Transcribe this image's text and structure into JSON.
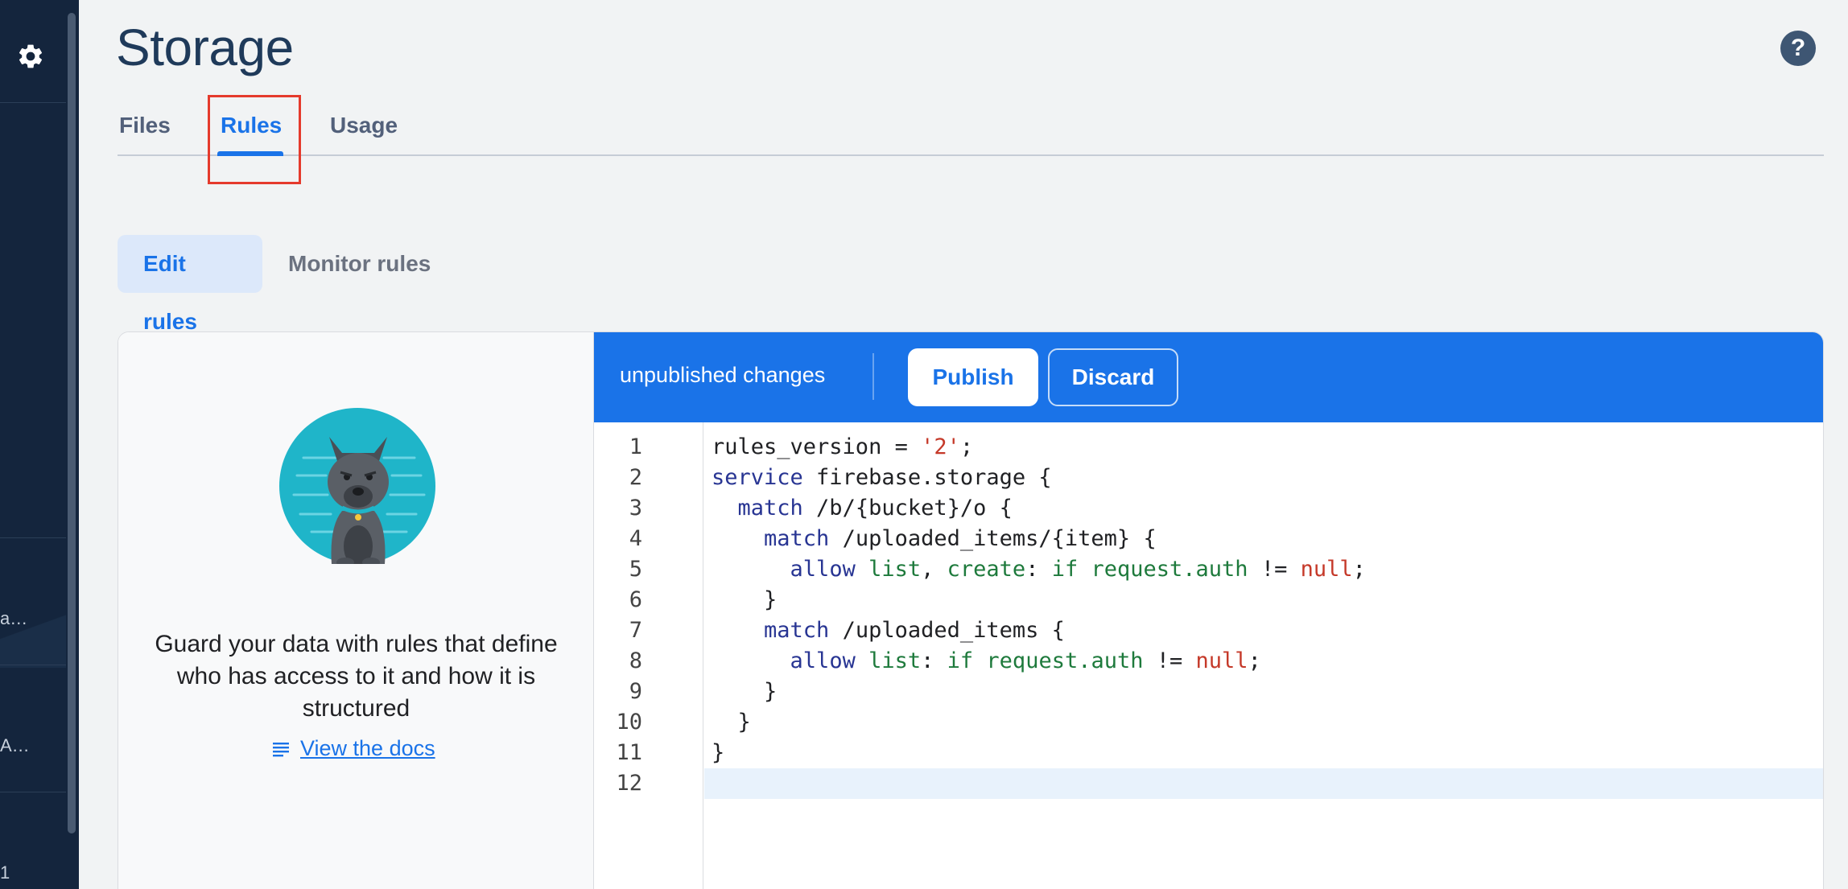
{
  "sidebar": {
    "gear_icon": "gear-icon",
    "text_a": "a…",
    "text_b": "A…",
    "text_c": "1"
  },
  "header": {
    "title": "Storage",
    "help_icon": "help-icon",
    "help_glyph": "?"
  },
  "tabs": [
    {
      "label": "Files",
      "active": false
    },
    {
      "label": "Rules",
      "active": true
    },
    {
      "label": "Usage",
      "active": false
    }
  ],
  "subtabs": {
    "edit": "Edit rules",
    "monitor": "Monitor rules"
  },
  "info_panel": {
    "text": "Guard your data with rules that define who has access to it and how it is structured",
    "docs_link": "View the docs"
  },
  "editor": {
    "status": "unpublished changes",
    "publish_label": "Publish",
    "discard_label": "Discard",
    "line_numbers": [
      "1",
      "2",
      "3",
      "4",
      "5",
      "6",
      "7",
      "8",
      "9",
      "10",
      "11",
      "12"
    ],
    "code": [
      "rules_version = '2';",
      "service firebase.storage {",
      "  match /b/{bucket}/o {",
      "    match /uploaded_items/{item} {",
      "      allow list, create: if request.auth != null;",
      "    }",
      "    match /uploaded_items {",
      "      allow list: if request.auth != null;",
      "    }",
      "  }",
      "}",
      ""
    ]
  },
  "colors": {
    "accent": "#1a73e8",
    "sidebar": "#14253d",
    "highlight": "#e53a2c"
  }
}
